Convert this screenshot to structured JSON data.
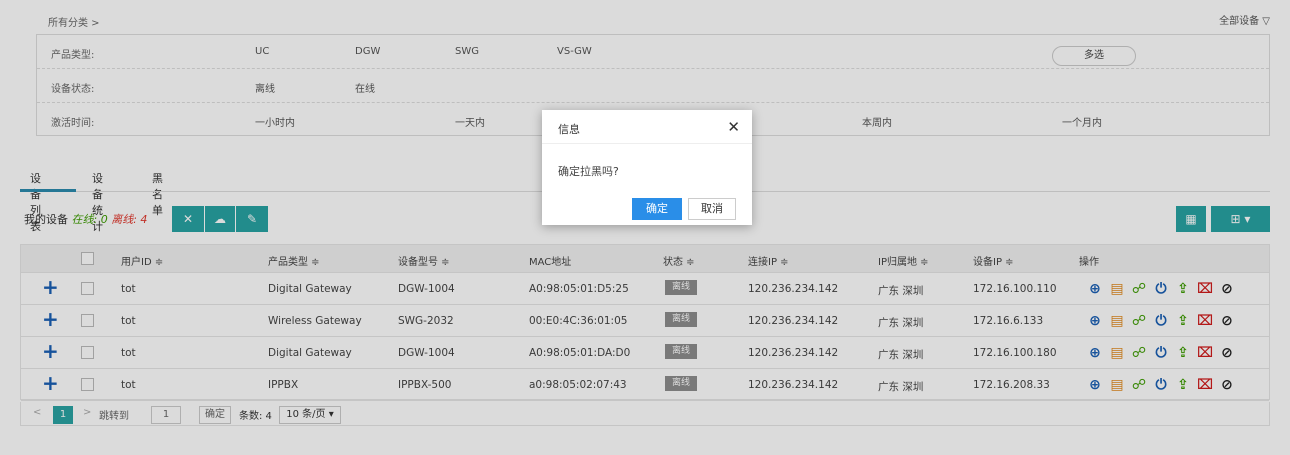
{
  "breadcrumb": "所有分类 >",
  "all_devices": "全部设备",
  "filters": {
    "product_type": {
      "label": "产品类型:",
      "options": [
        "UC",
        "DGW",
        "SWG",
        "VS-GW"
      ],
      "multi": "多选"
    },
    "device_status": {
      "label": "设备状态:",
      "options": [
        "离线",
        "在线"
      ]
    },
    "activation_time": {
      "label": "激活时间:",
      "options": [
        "一小时内",
        "一天内",
        "本周内",
        "一个月内"
      ]
    }
  },
  "tabs": [
    "设备列表",
    "设备统计",
    "黑名单"
  ],
  "summary": {
    "prefix": "我的设备 ",
    "online_label": "在线: ",
    "online": "0",
    "offline_label": "离线: ",
    "offline": "4"
  },
  "toolbar_icons": [
    "close-icon",
    "cloud-upload-icon",
    "edit-icon",
    "grid-icon",
    "columns-icon"
  ],
  "headers": [
    "用户ID ≑",
    "产品类型 ≑",
    "设备型号 ≑",
    "MAC地址",
    "状态 ≑",
    "连接IP ≑",
    "IP归属地 ≑",
    "设备IP ≑",
    "操作"
  ],
  "rows": [
    {
      "user": "tot",
      "type": "Digital Gateway",
      "model": "DGW-1004",
      "mac": "A0:98:05:01:D5:25",
      "status": "离线",
      "conn_ip": "120.236.234.142",
      "loc": "广东 深圳",
      "dev_ip": "172.16.100.110"
    },
    {
      "user": "tot",
      "type": "Wireless Gateway",
      "model": "SWG-2032",
      "mac": "00:E0:4C:36:01:05",
      "status": "离线",
      "conn_ip": "120.236.234.142",
      "loc": "广东 深圳",
      "dev_ip": "172.16.6.133"
    },
    {
      "user": "tot",
      "type": "Digital Gateway",
      "model": "DGW-1004",
      "mac": "A0:98:05:01:DA:D0",
      "status": "离线",
      "conn_ip": "120.236.234.142",
      "loc": "广东 深圳",
      "dev_ip": "172.16.100.180"
    },
    {
      "user": "tot",
      "type": "IPPBX",
      "model": "IPPBX-500",
      "mac": "a0:98:05:02:07:43",
      "status": "离线",
      "conn_ip": "120.236.234.142",
      "loc": "广东 深圳",
      "dev_ip": "172.16.208.33"
    }
  ],
  "pager": {
    "page": "1",
    "jump": "跳转到",
    "jump_value": "1",
    "confirm": "确定",
    "total": "条数: 4",
    "per_page": "10 条/页"
  },
  "dialog": {
    "title": "信息",
    "message": "确定拉黑吗?",
    "ok": "确定",
    "cancel": "取消"
  },
  "colors": {
    "accent": "#27a3a3",
    "primary": "#2a8ee8",
    "online": "#3c9c00",
    "offline": "#e0392f"
  }
}
